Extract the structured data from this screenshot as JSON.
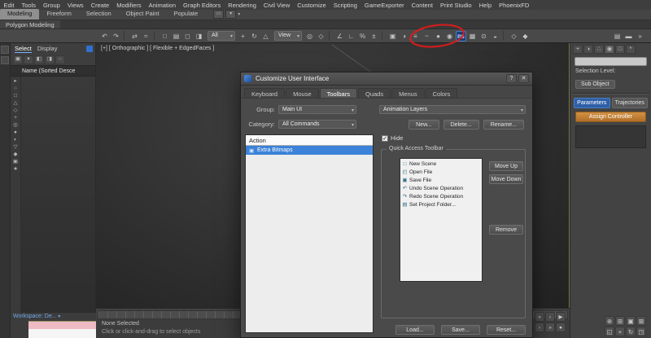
{
  "colors": {
    "selection_blue": "#3b82d8",
    "accent_blue": "#2f5fa8",
    "annotation_red": "#e01b1b",
    "assign_orange": "#c07f35",
    "workspace_link_blue": "#6fa8e8",
    "listener_pink": "#eebac3",
    "ps_badge_blue": "#1c3d74"
  },
  "menu_bar": {
    "items": [
      "Edit",
      "Tools",
      "Group",
      "Views",
      "Create",
      "Modifiers",
      "Animation",
      "Graph Editors",
      "Rendering",
      "Civil View",
      "Customize",
      "Scripting",
      "GameExporter",
      "Content",
      "Print Studio",
      "Help",
      "PhoenixFD"
    ]
  },
  "ribbon": {
    "tabs": [
      {
        "label": "Modeling",
        "active": true
      },
      {
        "label": "Freeform"
      },
      {
        "label": "Selection"
      },
      {
        "label": "Object Paint"
      },
      {
        "label": "Populate"
      }
    ],
    "panel_tab": "Polygon Modeling"
  },
  "toolbar": {
    "icons": [
      {
        "name": "undo-icon",
        "glyph": "↶"
      },
      {
        "name": "redo-icon",
        "glyph": "↷"
      },
      {
        "name": "toolbar-separator",
        "sep": true
      },
      {
        "name": "select-and-link-icon",
        "glyph": "⇄"
      },
      {
        "name": "bind-to-space-warp-icon",
        "glyph": "≈"
      },
      {
        "name": "toolbar-separator",
        "sep": true
      },
      {
        "name": "select-object-icon",
        "glyph": "□"
      },
      {
        "name": "select-by-name-icon",
        "glyph": "▤"
      },
      {
        "name": "rectangular-selection-region-icon",
        "glyph": "◻"
      },
      {
        "name": "window-crossing-icon",
        "glyph": "◨"
      },
      {
        "name": "selection-filter-combo",
        "glyph": "All",
        "combo": true
      },
      {
        "name": "select-and-move-icon",
        "glyph": "+"
      },
      {
        "name": "select-and-rotate-icon",
        "glyph": "↻"
      },
      {
        "name": "select-and-scale-icon",
        "glyph": "△"
      },
      {
        "name": "reference-coordinate-system-combo",
        "glyph": "View",
        "combo": true
      },
      {
        "name": "use-pivot-point-center-icon",
        "glyph": "◎"
      },
      {
        "name": "select-and-manipulate-icon",
        "glyph": "◇"
      },
      {
        "name": "toolbar-separator",
        "sep": true
      },
      {
        "name": "snaps-toggle-icon",
        "glyph": "∠"
      },
      {
        "name": "angle-snap-icon",
        "glyph": "∟"
      },
      {
        "name": "percent-snap-icon",
        "glyph": "%"
      },
      {
        "name": "spinner-snap-icon",
        "glyph": "±"
      },
      {
        "name": "toolbar-separator",
        "sep": true
      },
      {
        "name": "edit-named-selection-sets-icon",
        "glyph": "▣"
      },
      {
        "name": "mirror-icon",
        "glyph": "◑"
      },
      {
        "name": "align-icon",
        "glyph": "≡"
      },
      {
        "name": "curve-editor-icon",
        "glyph": "~"
      },
      {
        "name": "material-editor-icon",
        "glyph": "●"
      },
      {
        "name": "render-setup-icon",
        "glyph": "◉"
      },
      {
        "name": "photoshop-badge-icon",
        "glyph": "PS",
        "ps": true
      },
      {
        "name": "rendered-frame-window-icon",
        "glyph": "▦"
      },
      {
        "name": "render-production-icon",
        "glyph": "⊙"
      },
      {
        "name": "render-iterative-icon",
        "glyph": "◒"
      },
      {
        "name": "toolbar-separator",
        "sep": true
      },
      {
        "name": "open-container-icon",
        "glyph": "◇"
      },
      {
        "name": "phoenix-toolbar-icon",
        "glyph": "◆"
      }
    ],
    "right_icons": [
      {
        "name": "layer-explorer-icon",
        "glyph": "▤"
      },
      {
        "name": "ribbon-toggle-icon",
        "glyph": "▬"
      },
      {
        "name": "toolbar-overflow-icon",
        "glyph": "»"
      }
    ]
  },
  "viewport": {
    "label": "[+] [ Orthographic ] [ Flexible + EdgedFaces ]"
  },
  "scene_explorer": {
    "tabs": [
      {
        "label": "Select",
        "active": true
      },
      {
        "label": "Display"
      }
    ],
    "tool_icons": [
      {
        "name": "lock-selection-icon",
        "glyph": "▣"
      },
      {
        "name": "filter-combo-icon",
        "glyph": "▾"
      },
      {
        "name": "select-all-icon",
        "glyph": "◧"
      },
      {
        "name": "select-invert-icon",
        "glyph": "◨"
      },
      {
        "name": "search-icon",
        "glyph": "○"
      }
    ],
    "column_header": "Name (Sorted Desce",
    "side_icons": [
      {
        "name": "expand-all-icon",
        "glyph": "▸"
      },
      {
        "name": "display-none-icon",
        "glyph": "○"
      },
      {
        "name": "display-geometry-icon",
        "glyph": "□"
      },
      {
        "name": "display-shapes-icon",
        "glyph": "△"
      },
      {
        "name": "display-lights-icon",
        "glyph": "◇"
      },
      {
        "name": "display-cameras-icon",
        "glyph": "+"
      },
      {
        "name": "display-helpers-icon",
        "glyph": "◎"
      },
      {
        "name": "display-spacewarps-icon",
        "glyph": "●"
      },
      {
        "name": "display-groups-icon",
        "glyph": "◐"
      },
      {
        "name": "display-xrefs-icon",
        "glyph": "▽"
      },
      {
        "name": "display-bones-icon",
        "glyph": "◆"
      },
      {
        "name": "display-containers-icon",
        "glyph": "▣"
      },
      {
        "name": "display-materials-icon",
        "glyph": "★"
      }
    ]
  },
  "dialog": {
    "title": "Customize User Interface",
    "help_button": "?",
    "close_button": "✕",
    "tabs": [
      {
        "label": "Keyboard"
      },
      {
        "label": "Mouse"
      },
      {
        "label": "Toolbars",
        "active": true
      },
      {
        "label": "Quads"
      },
      {
        "label": "Menus"
      },
      {
        "label": "Colors"
      }
    ],
    "group_label": "Group:",
    "group_value": "Main UI",
    "category_label": "Category:",
    "category_value": "All Commands",
    "action_header": "Action",
    "selected_action": {
      "icon": "▣",
      "label": "Extra Bitmaps"
    },
    "toolbar_combo_value": "Animation Layers",
    "toolbar_buttons": [
      {
        "label": "New..."
      },
      {
        "label": "Delete..."
      },
      {
        "label": "Rename..."
      }
    ],
    "hide_label": "Hide",
    "check_glyph": "✓",
    "quick_access": {
      "title": "Quick Access Toolbar",
      "items": [
        {
          "icon": "□",
          "label": "New Scene"
        },
        {
          "icon": "◰",
          "label": "Open File"
        },
        {
          "icon": "▣",
          "label": "Save File"
        },
        {
          "icon": "↶",
          "label": "Undo Scene Operation"
        },
        {
          "icon": "↷",
          "label": "Redo Scene Operation"
        },
        {
          "icon": "▤",
          "label": "Set Project Folder..."
        }
      ],
      "move_up": "Move Up",
      "move_down": "Move Down",
      "remove": "Remove"
    },
    "footer_buttons": {
      "load": "Load...",
      "save": "Save...",
      "reset": "Reset..."
    }
  },
  "command_panel": {
    "tab_icons": [
      {
        "name": "create-tab-icon",
        "glyph": "+"
      },
      {
        "name": "modify-tab-icon",
        "glyph": "◑"
      },
      {
        "name": "hierarchy-tab-icon",
        "glyph": "∴"
      },
      {
        "name": "motion-tab-icon",
        "glyph": "◉",
        "active": true
      },
      {
        "name": "display-tab-icon",
        "glyph": "□"
      },
      {
        "name": "utilities-tab-icon",
        "glyph": "*"
      }
    ],
    "selection_level_label": "Selection Level:",
    "sub_object_button": "Sub Object",
    "parameters_button": "Parameters",
    "trajectories_button": "Trajectories",
    "assign_controller_label": "Assign Controller",
    "nav_icons": [
      {
        "name": "zoom-icon",
        "glyph": "⊕"
      },
      {
        "name": "zoom-all-icon",
        "glyph": "⊞"
      },
      {
        "name": "zoom-extents-icon",
        "glyph": "▣"
      },
      {
        "name": "zoom-extents-all-icon",
        "glyph": "⊠"
      },
      {
        "name": "zoom-region-icon",
        "glyph": "◱"
      },
      {
        "name": "pan-view-icon",
        "glyph": "+"
      },
      {
        "name": "orbit-icon",
        "glyph": "↻"
      },
      {
        "name": "maximize-viewport-toggle-icon",
        "glyph": "◳"
      }
    ]
  },
  "animation_controls": {
    "icons": [
      {
        "name": "go-to-start-icon",
        "glyph": "«"
      },
      {
        "name": "previous-frame-icon",
        "glyph": "‹"
      },
      {
        "name": "play-animation-icon",
        "glyph": "▶"
      },
      {
        "name": "next-frame-icon",
        "glyph": "›"
      },
      {
        "name": "go-to-end-icon",
        "glyph": "»"
      },
      {
        "name": "key-mode-toggle-icon",
        "glyph": "●"
      }
    ]
  },
  "status_bar": {
    "selection": "None Selected",
    "prompt": "Click or click-and-drag to select objects",
    "workspace": "Workspace: De..."
  }
}
